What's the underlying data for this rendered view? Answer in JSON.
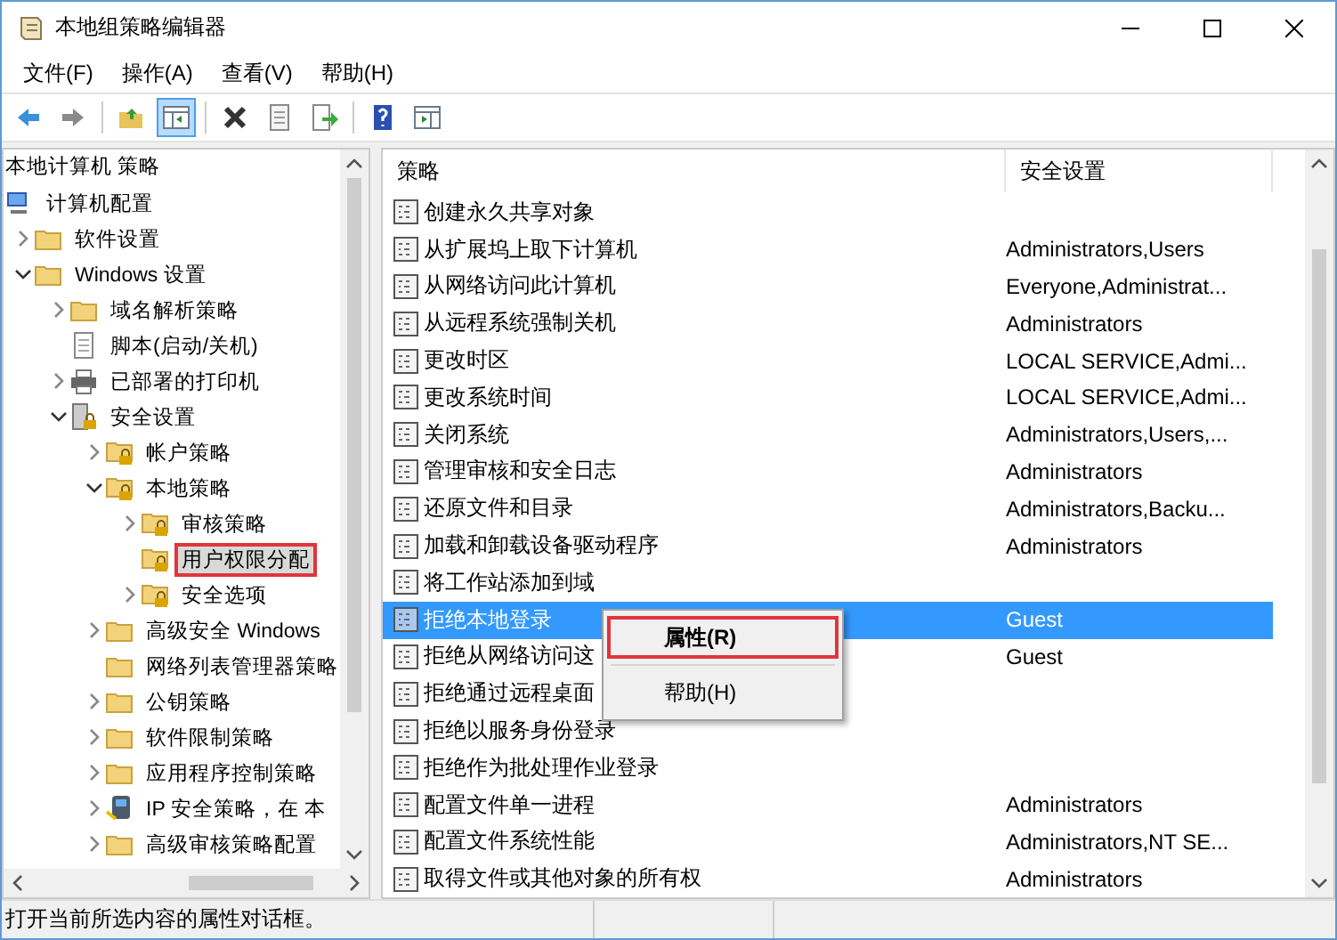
{
  "window": {
    "title": "本地组策略编辑器"
  },
  "menu": [
    "文件(F)",
    "操作(A)",
    "查看(V)",
    "帮助(H)"
  ],
  "toolbar": [
    [
      {
        "kind": "back",
        "pressed": false
      },
      {
        "kind": "forward",
        "pressed": false
      }
    ],
    [
      {
        "kind": "up",
        "pressed": false
      },
      {
        "kind": "tree",
        "pressed": true
      }
    ],
    [
      {
        "kind": "delete",
        "pressed": false
      },
      {
        "kind": "properties",
        "pressed": false
      },
      {
        "kind": "export",
        "pressed": false
      }
    ],
    [
      {
        "kind": "help",
        "pressed": false
      },
      {
        "kind": "panel",
        "pressed": false
      }
    ]
  ],
  "tree": {
    "header": "本地计算机 策略",
    "items": [
      {
        "label": "计算机配置",
        "kind": "computer",
        "selected": false,
        "highlighted": false,
        "children": [
          {
            "label": "软件设置",
            "kind": "folder",
            "expanded": false,
            "selected": false,
            "highlighted": false
          },
          {
            "label": "Windows 设置",
            "kind": "folder",
            "expanded": true,
            "selected": false,
            "highlighted": false,
            "children": [
              {
                "label": "域名解析策略",
                "kind": "folder",
                "expanded": false,
                "selected": false,
                "highlighted": false
              },
              {
                "label": "脚本(启动/关机)",
                "kind": "script",
                "selected": false,
                "highlighted": false
              },
              {
                "label": "已部署的打印机",
                "kind": "printer",
                "expanded": false,
                "selected": false,
                "highlighted": false
              },
              {
                "label": "安全设置",
                "kind": "secserver",
                "expanded": true,
                "selected": false,
                "highlighted": false,
                "children": [
                  {
                    "label": "帐户策略",
                    "kind": "lockfolder",
                    "expanded": false,
                    "selected": false,
                    "highlighted": false
                  },
                  {
                    "label": "本地策略",
                    "kind": "lockfolder",
                    "expanded": true,
                    "selected": false,
                    "highlighted": false,
                    "children": [
                      {
                        "label": "审核策略",
                        "kind": "lockfolder",
                        "expanded": false,
                        "selected": false,
                        "highlighted": false
                      },
                      {
                        "label": "用户权限分配",
                        "kind": "lockfolder",
                        "selected": true,
                        "highlighted": true
                      },
                      {
                        "label": "安全选项",
                        "kind": "lockfolder",
                        "expanded": false,
                        "selected": false,
                        "highlighted": false
                      }
                    ]
                  },
                  {
                    "label": "高级安全 Windows",
                    "kind": "folder",
                    "expanded": false,
                    "selected": false,
                    "highlighted": false
                  },
                  {
                    "label": "网络列表管理器策略",
                    "kind": "folder",
                    "selected": false,
                    "highlighted": false
                  },
                  {
                    "label": "公钥策略",
                    "kind": "folder",
                    "expanded": false,
                    "selected": false,
                    "highlighted": false
                  },
                  {
                    "label": "软件限制策略",
                    "kind": "folder",
                    "expanded": false,
                    "selected": false,
                    "highlighted": false
                  },
                  {
                    "label": "应用程序控制策略",
                    "kind": "folder",
                    "expanded": false,
                    "selected": false,
                    "highlighted": false
                  },
                  {
                    "label": "IP 安全策略，在 本",
                    "kind": "ipsec",
                    "expanded": false,
                    "selected": false,
                    "highlighted": false
                  },
                  {
                    "label": "高级审核策略配置",
                    "kind": "folder",
                    "expanded": false,
                    "selected": false,
                    "highlighted": false
                  }
                ]
              }
            ]
          }
        ]
      }
    ]
  },
  "list": {
    "columns": [
      "策略",
      "安全设置"
    ],
    "rows": [
      {
        "policy": "创建永久共享对象",
        "setting": "",
        "selected": false
      },
      {
        "policy": "从扩展坞上取下计算机",
        "setting": "Administrators,Users",
        "selected": false
      },
      {
        "policy": "从网络访问此计算机",
        "setting": "Everyone,Administrat...",
        "selected": false
      },
      {
        "policy": "从远程系统强制关机",
        "setting": "Administrators",
        "selected": false
      },
      {
        "policy": "更改时区",
        "setting": "LOCAL SERVICE,Admi...",
        "selected": false
      },
      {
        "policy": "更改系统时间",
        "setting": "LOCAL SERVICE,Admi...",
        "selected": false
      },
      {
        "policy": "关闭系统",
        "setting": "Administrators,Users,...",
        "selected": false
      },
      {
        "policy": "管理审核和安全日志",
        "setting": "Administrators",
        "selected": false
      },
      {
        "policy": "还原文件和目录",
        "setting": "Administrators,Backu...",
        "selected": false
      },
      {
        "policy": "加载和卸载设备驱动程序",
        "setting": "Administrators",
        "selected": false
      },
      {
        "policy": "将工作站添加到域",
        "setting": "",
        "selected": false
      },
      {
        "policy": "拒绝本地登录",
        "setting": "Guest",
        "selected": true
      },
      {
        "policy": "拒绝从网络访问这",
        "setting": "Guest",
        "selected": false
      },
      {
        "policy": "拒绝通过远程桌面",
        "setting": "",
        "selected": false
      },
      {
        "policy": "拒绝以服务身份登录",
        "setting": "",
        "selected": false
      },
      {
        "policy": "拒绝作为批处理作业登录",
        "setting": "",
        "selected": false
      },
      {
        "policy": "配置文件单一进程",
        "setting": "Administrators",
        "selected": false
      },
      {
        "policy": "配置文件系统性能",
        "setting": "Administrators,NT SE...",
        "selected": false
      },
      {
        "policy": "取得文件或其他对象的所有权",
        "setting": "Administrators",
        "selected": false
      }
    ]
  },
  "context_menu": [
    {
      "label": "属性(R)",
      "kind": "item",
      "default": true,
      "highlighted": true
    },
    {
      "kind": "separator"
    },
    {
      "label": "帮助(H)",
      "kind": "item",
      "default": false,
      "highlighted": false
    }
  ],
  "status_bar": "打开当前所选内容的属性对话框。"
}
